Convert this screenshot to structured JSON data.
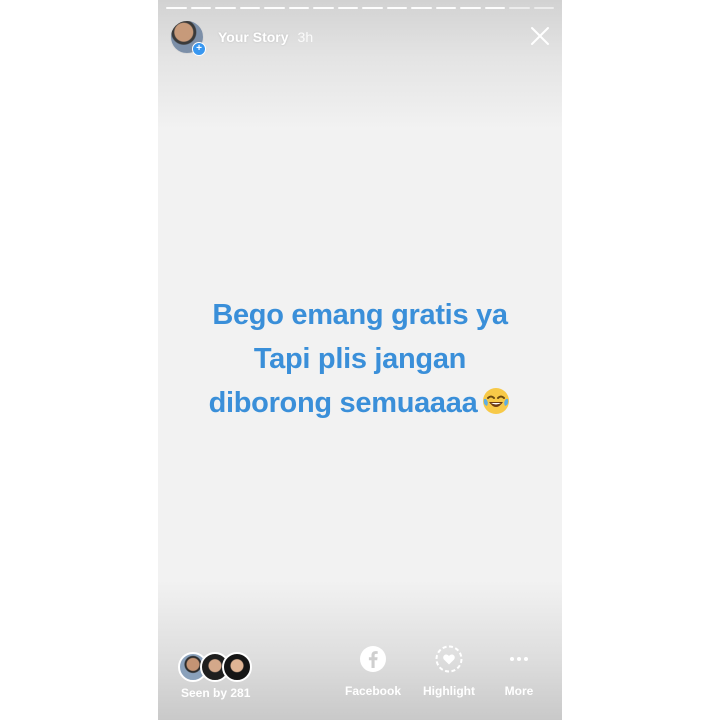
{
  "header": {
    "title": "Your Story",
    "time": "3h",
    "progress_segments": 16,
    "progress_active_segments": 14
  },
  "caption": {
    "lines": [
      "Bego emang gratis ya",
      "Tapi plis jangan",
      "diborong semuaaaa"
    ],
    "emoji": "tears-of-joy-emoji",
    "color": "#3a8fd9"
  },
  "footer": {
    "seen_label": "Seen by 281",
    "actions": [
      {
        "label": "Facebook",
        "icon": "facebook-icon"
      },
      {
        "label": "Highlight",
        "icon": "highlight-heart-icon"
      },
      {
        "label": "More",
        "icon": "more-dots-icon"
      }
    ]
  },
  "colors": {
    "accent_blue": "#3897f0",
    "text_blue": "#3a8fd9",
    "background": "#f2f2f2"
  }
}
